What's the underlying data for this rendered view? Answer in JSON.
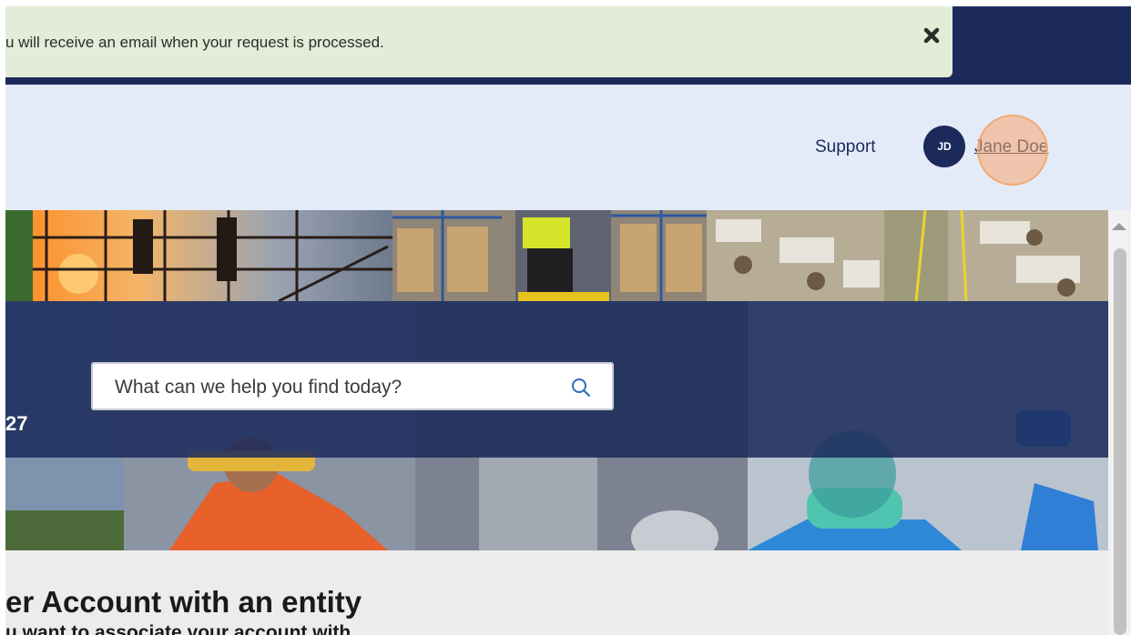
{
  "notification": {
    "message": "u will receive an email when your request is processed.",
    "close_icon": "close-x-icon"
  },
  "header": {
    "support_label": "Support",
    "user": {
      "initials": "JD",
      "name": "Jane Doe"
    }
  },
  "hero": {
    "search": {
      "placeholder": "What can we help you find today?",
      "icon": "search-icon"
    },
    "partial_label": "27"
  },
  "main": {
    "title": "er Account with an entity",
    "subtitle": "u want to associate your account with"
  },
  "colors": {
    "navy": "#1b2a5b",
    "toast_bg": "#e2ecd7",
    "header_bg": "#e4ebf8",
    "content_bg": "#ececec",
    "click_indicator": "#f3a871"
  }
}
